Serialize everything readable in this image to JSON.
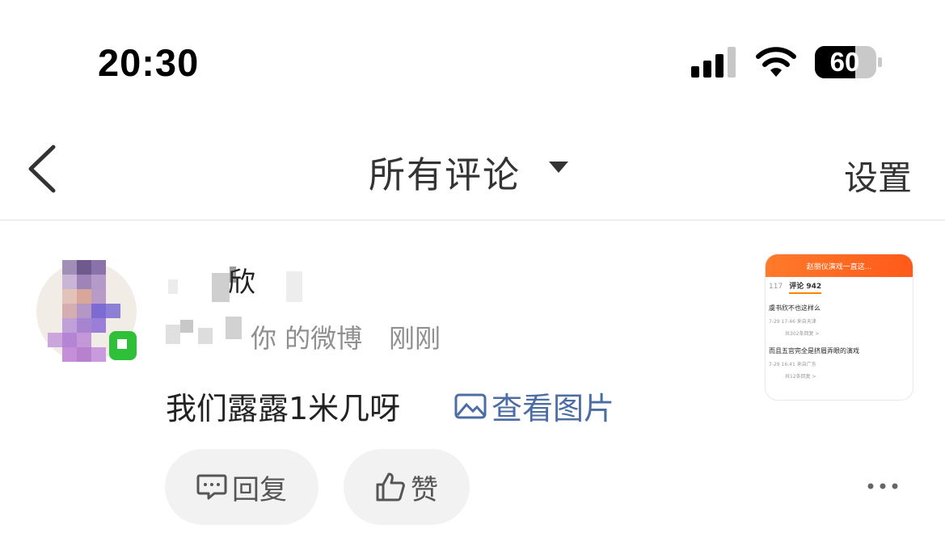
{
  "status_bar": {
    "time": "20:30",
    "battery_level": "60",
    "icons": [
      "signal-icon",
      "wifi-icon",
      "battery-icon"
    ]
  },
  "nav": {
    "back_icon": "chevron-left-icon",
    "title": "所有评论",
    "title_dropdown_icon": "caret-down-icon",
    "settings_label": "设置"
  },
  "comment": {
    "username_visible": "欣",
    "source": "你 的微博",
    "time": "刚刚",
    "text": "我们露露1米几呀",
    "view_image_label": "查看图片",
    "thumbnail": {
      "header": "赵丽仪演戏一直这...",
      "tab_count": "117",
      "tab_label": "评论 942",
      "item1_text": "虞书欣不也这样么",
      "item1_meta": "7-29 17:46 来自天津",
      "item1_replies": "共302条回复 >",
      "item2_text": "而且五官完全是挤眉弄眼的演戏",
      "item2_meta": "7-29 16:41 来自广东",
      "item2_replies": "共12条回复 >"
    },
    "reply_label": "回复",
    "like_label": "赞",
    "more_icon": "more-dots-icon"
  },
  "colors": {
    "link": "#4c6da3",
    "meta_gray": "#8f8f8f",
    "button_bg": "#f2f2f2",
    "accent_orange": "#ff7a2b"
  }
}
